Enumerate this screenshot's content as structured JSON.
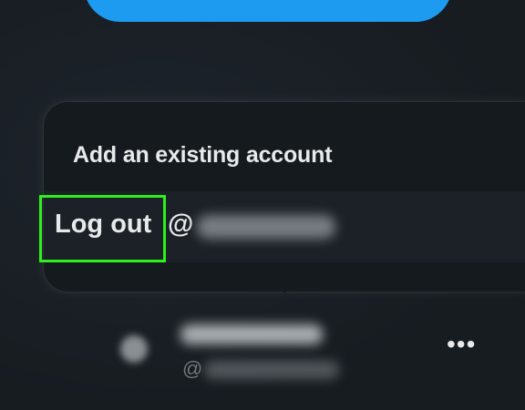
{
  "menu": {
    "add_account_label": "Add an existing account",
    "logout_label": "Log out",
    "logout_handle_prefix": "@"
  },
  "account": {
    "handle_prefix": "@",
    "more_icon": "•••"
  },
  "colors": {
    "post_button": "#1d9bf0",
    "highlight": "#2df01c",
    "text_primary": "#e7e9ea",
    "text_secondary": "#71767b"
  }
}
